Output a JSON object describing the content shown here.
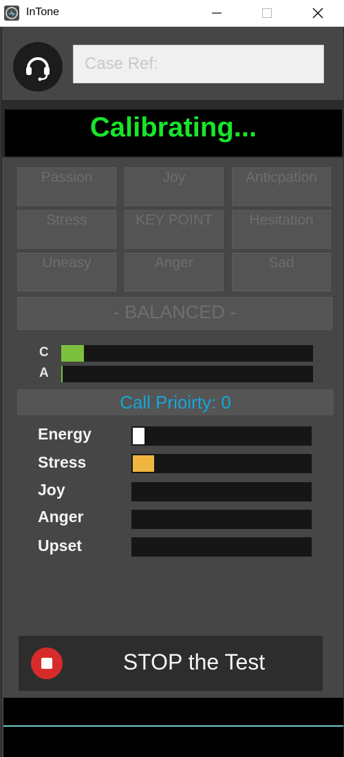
{
  "window": {
    "title": "InTone",
    "minimize_symbol": "—",
    "maximize_symbol": "☐",
    "close_symbol": "✕"
  },
  "header": {
    "icon": "headset-icon",
    "case_ref_placeholder": "Case Ref:",
    "case_ref_value": ""
  },
  "status": {
    "text": "Calibrating...",
    "color": "#16e62b"
  },
  "emotions": {
    "tiles": [
      "Passion",
      "Joy",
      "Anticpation",
      "Stress",
      "KEY POINT",
      "Hesitation",
      "Uneasy",
      "Anger",
      "Sad"
    ],
    "balanced_label": "- BALANCED -"
  },
  "ca_bars": [
    {
      "label": "C",
      "level": 0.09,
      "color": "#7cc03e"
    },
    {
      "label": "A",
      "level": 0.005,
      "color": "#7cc03e"
    }
  ],
  "priority": {
    "text": "Call Prioirty: 0",
    "color": "#14a7d8"
  },
  "meters": [
    {
      "label": "Energy",
      "level": 0.065,
      "color": "#ffffff"
    },
    {
      "label": "Stress",
      "level": 0.12,
      "color": "#f0b63f"
    },
    {
      "label": "Joy",
      "level": 0,
      "color": "#ffffff"
    },
    {
      "label": "Anger",
      "level": 0,
      "color": "#ffffff"
    },
    {
      "label": "Upset",
      "level": 0,
      "color": "#ffffff"
    }
  ],
  "stop_button": {
    "label": "STOP the Test",
    "icon": "stop-icon",
    "icon_color": "#d72b2b"
  }
}
